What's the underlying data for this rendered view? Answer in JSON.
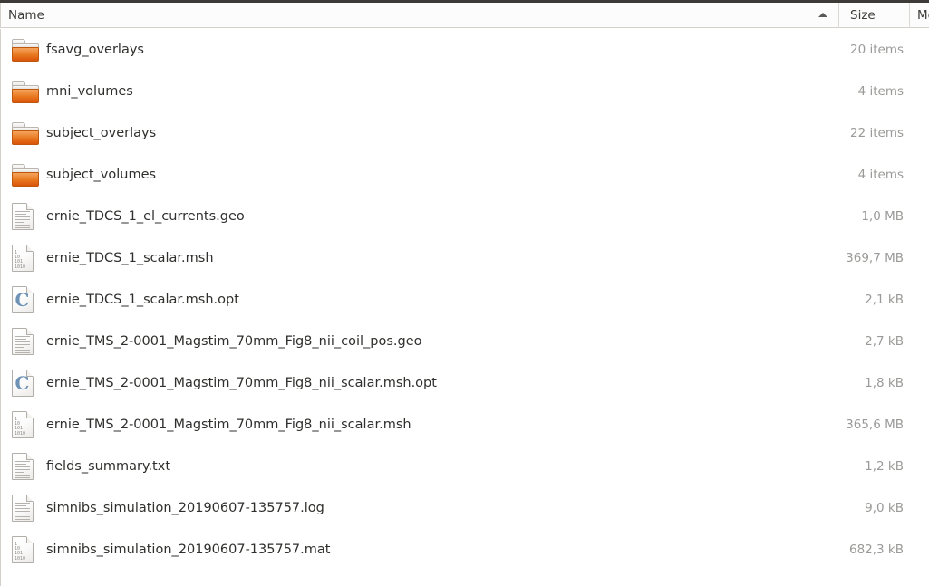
{
  "columns": {
    "name": "Name",
    "size": "Size",
    "modified": "Mo",
    "sort_indicator": "ascending-arrow",
    "sorted_by": "Name"
  },
  "rows": [
    {
      "name": "fsavg_overlays",
      "size": "20 items",
      "icon": "folder"
    },
    {
      "name": "mni_volumes",
      "size": "4 items",
      "icon": "folder"
    },
    {
      "name": "subject_overlays",
      "size": "22 items",
      "icon": "folder"
    },
    {
      "name": "subject_volumes",
      "size": "4 items",
      "icon": "folder"
    },
    {
      "name": "ernie_TDCS_1_el_currents.geo",
      "size": "1,0 MB",
      "icon": "text-document"
    },
    {
      "name": "ernie_TDCS_1_scalar.msh",
      "size": "369,7 MB",
      "icon": "binary-document"
    },
    {
      "name": "ernie_TDCS_1_scalar.msh.opt",
      "size": "2,1 kB",
      "icon": "code-document"
    },
    {
      "name": "ernie_TMS_2-0001_Magstim_70mm_Fig8_nii_coil_pos.geo",
      "size": "2,7 kB",
      "icon": "text-document"
    },
    {
      "name": "ernie_TMS_2-0001_Magstim_70mm_Fig8_nii_scalar.msh.opt",
      "size": "1,8 kB",
      "icon": "code-document"
    },
    {
      "name": "ernie_TMS_2-0001_Magstim_70mm_Fig8_nii_scalar.msh",
      "size": "365,6 MB",
      "icon": "binary-document"
    },
    {
      "name": "fields_summary.txt",
      "size": "1,2 kB",
      "icon": "text-document"
    },
    {
      "name": "simnibs_simulation_20190607-135757.log",
      "size": "9,0 kB",
      "icon": "text-document"
    },
    {
      "name": "simnibs_simulation_20190607-135757.mat",
      "size": "682,3 kB",
      "icon": "binary-document"
    }
  ],
  "colors": {
    "folder_orange": "#e8781f",
    "code_glyph_blue": "#6f93b4",
    "size_text": "#9a9a98",
    "name_text": "#2f2f2d",
    "header_bg": "#fcfcfc",
    "border": "#d4d0cb",
    "top_edge": "#3c3b37"
  },
  "icon_digits": [
    "1",
    "10",
    "101",
    "1010"
  ]
}
